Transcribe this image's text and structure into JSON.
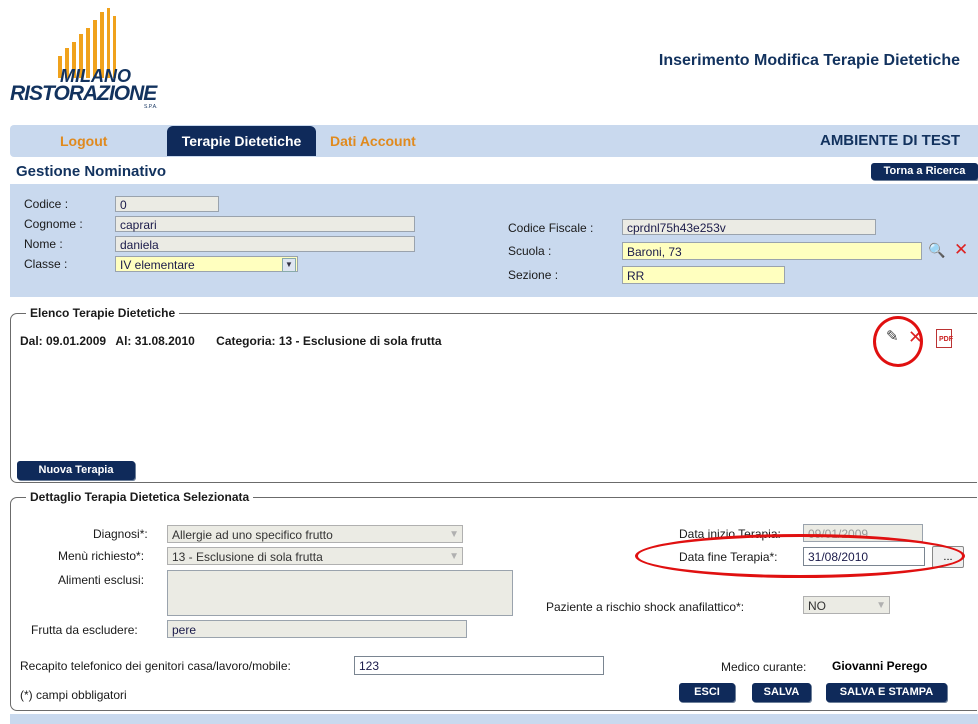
{
  "logo": {
    "line1": "MILANO",
    "line2": "RISTORAZIONE",
    "line3": "S.P.A."
  },
  "page_title": "Inserimento Modifica Terapie Dietetiche",
  "nav": {
    "logout": "Logout",
    "terapie": "Terapie Dietetiche",
    "dati": "Dati Account",
    "env": "AMBIENTE DI TEST"
  },
  "gestione": {
    "title": "Gestione Nominativo",
    "torna_label": "Torna a Ricerca",
    "codice_label": "Codice :",
    "codice": "0",
    "cognome_label": "Cognome :",
    "cognome": "caprari",
    "nome_label": "Nome :",
    "nome": "daniela",
    "classe_label": "Classe :",
    "classe": "IV elementare",
    "cf_label": "Codice Fiscale :",
    "cf": "cprdnl75h43e253v",
    "scuola_label": "Scuola :",
    "scuola": "Baroni, 73",
    "sezione_label": "Sezione :",
    "sezione": "RR"
  },
  "elenco": {
    "legend": "Elenco Terapie Dietetiche",
    "dal_label": "Dal:",
    "dal": "09.01.2009",
    "al_label": "Al:",
    "al": "31.08.2010",
    "cat_label": "Categoria:",
    "cat": "13 - Esclusione di sola frutta",
    "nuova_label": "Nuova Terapia"
  },
  "dettaglio": {
    "legend": "Dettaglio Terapia Dietetica Selezionata",
    "diagnosi_label": "Diagnosi*:",
    "diagnosi": "Allergie ad uno specifico frutto",
    "menu_label": "Menù richiesto*:",
    "menu": "13 - Esclusione di sola frutta",
    "alimenti_label": "Alimenti esclusi:",
    "frutta_label": "Frutta da escludere:",
    "frutta": "pere",
    "recapito_label": "Recapito telefonico dei genitori casa/lavoro/mobile:",
    "recapito": "123",
    "campi_note": "(*) campi obbligatori",
    "data_inizio_label": "Data inizio Terapia:",
    "data_inizio": "09/01/2009",
    "data_fine_label": "Data fine Terapia*:",
    "data_fine": "31/08/2010",
    "dots_label": "...",
    "shock_label": "Paziente a rischio shock anafilattico*:",
    "shock": "NO",
    "medico_label": "Medico curante:",
    "medico": "Giovanni Perego",
    "esci_label": "ESCI",
    "salva_label": "SALVA",
    "salva_stampa_label": "SALVA E STAMPA"
  },
  "colors": {
    "navy": "#0f2a5a",
    "orange": "#e08a1e",
    "panel": "#c9d9ee",
    "yellow_field": "#ffffbf",
    "highlight": "#e01010"
  }
}
